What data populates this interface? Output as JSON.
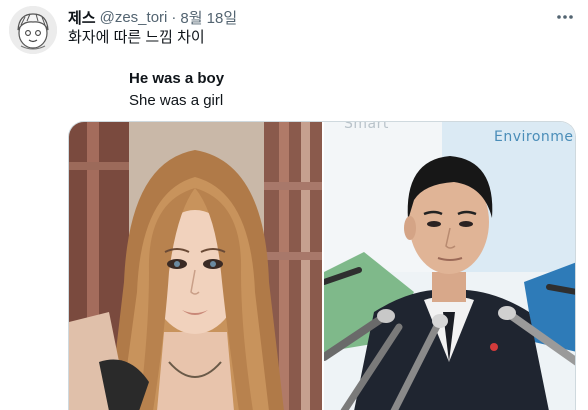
{
  "tweet": {
    "display_name": "제스",
    "handle": "@zes_tori",
    "separator": "·",
    "date": "8월 18일",
    "text": "화자에 따른 느낌 차이",
    "more_icon": "more-horizontal-icon"
  },
  "quote": {
    "line1": "He was a boy",
    "line2": "She was a girl"
  },
  "media": {
    "left_photo": "photo of a woman with long light-brown hair and dark eye makeup",
    "right_photo": "photo of a man in a dark suit at a press conference with microphones",
    "sign_top": "Smart",
    "sign_right": "Environme"
  },
  "colors": {
    "secondary_text": "#536471",
    "border": "#cfd9de",
    "sign_blue": "#4a8db8"
  }
}
